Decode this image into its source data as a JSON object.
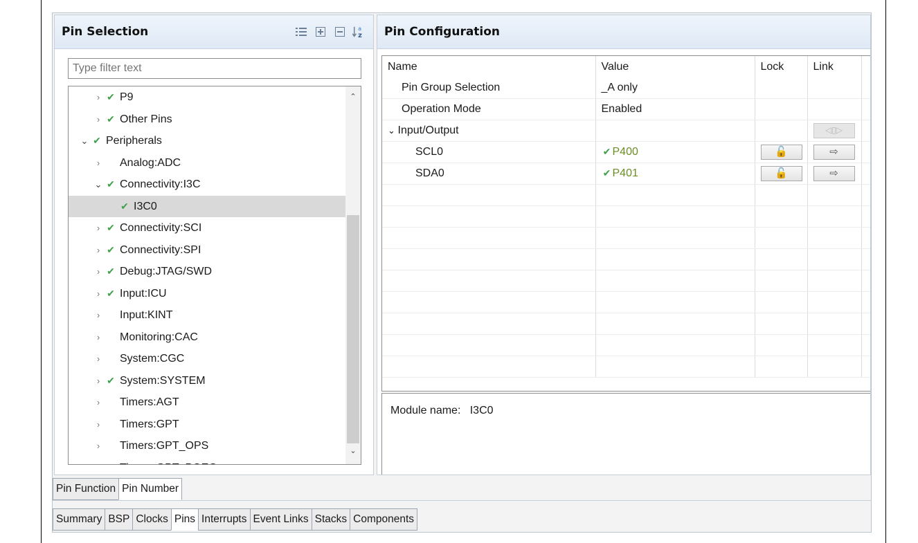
{
  "pin_selection": {
    "title": "Pin Selection",
    "icons": [
      "list-view-icon",
      "expand-all-icon",
      "collapse-all-icon",
      "sort-az-icon"
    ],
    "filter_placeholder": "Type filter text",
    "tree": [
      {
        "label": "P9",
        "indent": 1,
        "twisty": "closed",
        "check": true
      },
      {
        "label": "Other Pins",
        "indent": 1,
        "twisty": "closed",
        "check": true
      },
      {
        "label": "Peripherals",
        "indent": 0,
        "twisty": "open",
        "check": true
      },
      {
        "label": "Analog:ADC",
        "indent": 1,
        "twisty": "closed",
        "check": false
      },
      {
        "label": "Connectivity:I3C",
        "indent": 1,
        "twisty": "open",
        "check": true
      },
      {
        "label": "I3C0",
        "indent": 2,
        "twisty": "none",
        "check": true,
        "selected": true
      },
      {
        "label": "Connectivity:SCI",
        "indent": 1,
        "twisty": "closed",
        "check": true
      },
      {
        "label": "Connectivity:SPI",
        "indent": 1,
        "twisty": "closed",
        "check": true
      },
      {
        "label": "Debug:JTAG/SWD",
        "indent": 1,
        "twisty": "closed",
        "check": true
      },
      {
        "label": "Input:ICU",
        "indent": 1,
        "twisty": "closed",
        "check": true
      },
      {
        "label": "Input:KINT",
        "indent": 1,
        "twisty": "closed",
        "check": false
      },
      {
        "label": "Monitoring:CAC",
        "indent": 1,
        "twisty": "closed",
        "check": false
      },
      {
        "label": "System:CGC",
        "indent": 1,
        "twisty": "closed",
        "check": false
      },
      {
        "label": "System:SYSTEM",
        "indent": 1,
        "twisty": "closed",
        "check": true
      },
      {
        "label": "Timers:AGT",
        "indent": 1,
        "twisty": "closed",
        "check": false
      },
      {
        "label": "Timers:GPT",
        "indent": 1,
        "twisty": "closed",
        "check": false
      },
      {
        "label": "Timers:GPT_OPS",
        "indent": 1,
        "twisty": "closed",
        "check": false
      },
      {
        "label": "Timers:GPT_POEG",
        "indent": 1,
        "twisty": "closed",
        "check": false
      }
    ]
  },
  "pin_config": {
    "title": "Pin Configuration",
    "columns": [
      "Name",
      "Value",
      "Lock",
      "Link"
    ],
    "rows": [
      {
        "name": "Pin Group Selection",
        "value": "_A only",
        "indent": 1
      },
      {
        "name": "Operation Mode",
        "value": "Enabled",
        "indent": 1
      },
      {
        "name": "Input/Output",
        "value": "",
        "indent": 0,
        "group": true
      },
      {
        "name": "SCL0",
        "value": "P400",
        "indent": 2,
        "green": true,
        "lock": true,
        "link": true
      },
      {
        "name": "SDA0",
        "value": "P401",
        "indent": 2,
        "green": true,
        "lock": true,
        "link": true
      }
    ],
    "empty_rows": 9,
    "module_label": "Module name:",
    "module_value": "I3C0"
  },
  "inner_tabs": [
    {
      "label": "Pin Function",
      "active": false
    },
    {
      "label": "Pin Number",
      "active": true
    }
  ],
  "outer_tabs": [
    {
      "label": "Summary",
      "active": false
    },
    {
      "label": "BSP",
      "active": false
    },
    {
      "label": "Clocks",
      "active": false
    },
    {
      "label": "Pins",
      "active": true
    },
    {
      "label": "Interrupts",
      "active": false
    },
    {
      "label": "Event Links",
      "active": false
    },
    {
      "label": "Stacks",
      "active": false
    },
    {
      "label": "Components",
      "active": false
    }
  ],
  "colors": {
    "check": "#3fa04b",
    "pin_value": "#6b8e23",
    "header_bg": "#dfe9f5",
    "selected_row": "#d9d9d9"
  }
}
